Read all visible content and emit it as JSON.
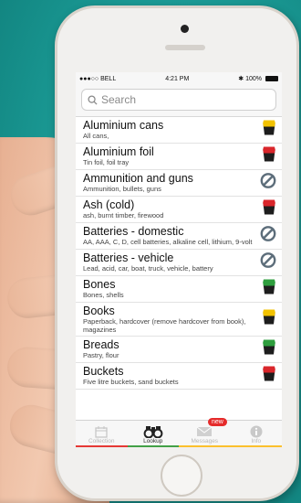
{
  "status_bar": {
    "carrier": "●●●○○ BELL",
    "time": "4:21 PM",
    "battery": "100%"
  },
  "search": {
    "placeholder": "Search"
  },
  "items": [
    {
      "title": "Aluminium cans",
      "desc": "All cans,",
      "icon": "yellow-bin-icon"
    },
    {
      "title": "Aluminium foil",
      "desc": "Tin foil, foil tray",
      "icon": "red-bin-icon"
    },
    {
      "title": "Ammunition and guns",
      "desc": "Ammunition, bullets, guns",
      "icon": "not-allowed-icon"
    },
    {
      "title": "Ash (cold)",
      "desc": "ash, burnt timber, firewood",
      "icon": "red-bin-icon"
    },
    {
      "title": "Batteries - domestic",
      "desc": "AA, AAA, C, D, cell batteries, alkaline cell, lithium, 9-volt",
      "icon": "not-allowed-icon"
    },
    {
      "title": "Batteries - vehicle",
      "desc": "Lead, acid, car, boat, truck, vehicle, battery",
      "icon": "not-allowed-icon"
    },
    {
      "title": "Bones",
      "desc": "Bones, shells",
      "icon": "green-bin-icon"
    },
    {
      "title": "Books",
      "desc": "Paperback, hardcover (remove hardcover from book), magazines",
      "icon": "yellow-bin-icon"
    },
    {
      "title": "Breads",
      "desc": "Pastry, flour",
      "icon": "green-bin-icon"
    },
    {
      "title": "Buckets",
      "desc": "Five litre buckets, sand buckets",
      "icon": "red-bin-icon"
    }
  ],
  "tabs": [
    {
      "label": "Collection",
      "icon": "calendar-icon",
      "color": "#e53935"
    },
    {
      "label": "Lookup",
      "icon": "binoculars-icon",
      "color": "#43a047"
    },
    {
      "label": "Messages",
      "icon": "envelope-icon",
      "color": "#fbc02d",
      "badge": "new"
    },
    {
      "label": "Info",
      "icon": "info-icon",
      "color": "#fbc02d"
    }
  ],
  "colors": {
    "yellow": "#f2c200",
    "red": "#d9262b",
    "green": "#2e9e3e",
    "background": "#18948f"
  }
}
